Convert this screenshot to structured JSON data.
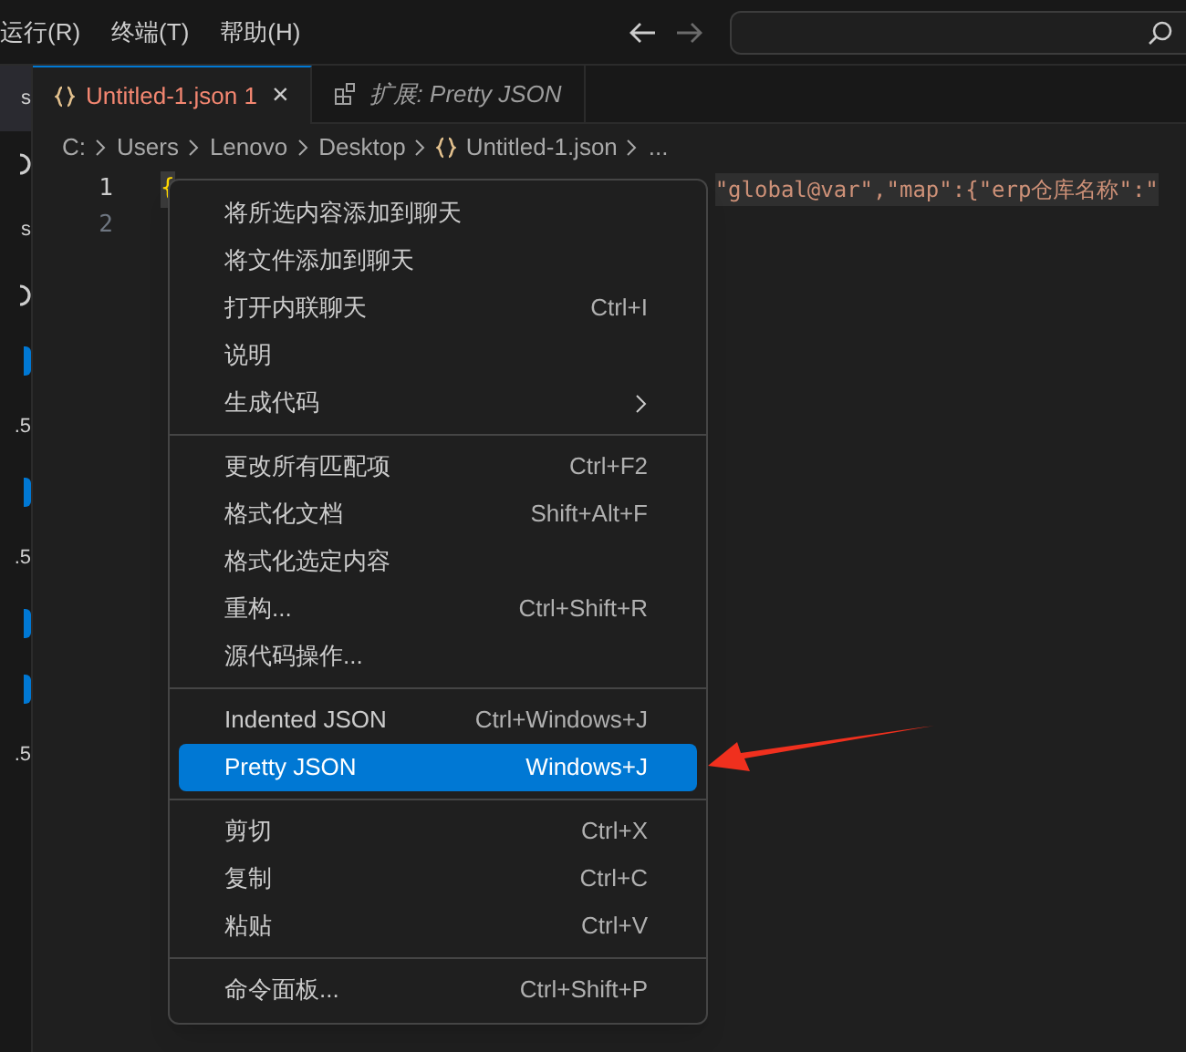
{
  "menubar": {
    "items": [
      "运行(R)",
      "终端(T)",
      "帮助(H)"
    ]
  },
  "sidebar": {
    "texts": [
      "s",
      "s",
      ".5",
      ".5",
      ".5"
    ]
  },
  "tabs": [
    {
      "label": "Untitled-1.json 1",
      "kind": "file",
      "selected": true,
      "close": "×"
    },
    {
      "label": "扩展: Pretty JSON",
      "kind": "extension",
      "selected": false
    }
  ],
  "breadcrumb": [
    {
      "label": "C:",
      "kind": "folder"
    },
    {
      "label": "Users",
      "kind": "folder"
    },
    {
      "label": "Lenovo",
      "kind": "folder"
    },
    {
      "label": "Desktop",
      "kind": "folder"
    },
    {
      "label": "Untitled-1.json",
      "kind": "file"
    },
    {
      "label": "...",
      "kind": "more"
    }
  ],
  "editor": {
    "lines": [
      {
        "number": "1",
        "start": "{",
        "tail": "\"global@var\",\"map\":{\"erp仓库名称\":\""
      },
      {
        "number": "2"
      }
    ]
  },
  "context_menu": {
    "groups": [
      [
        {
          "label": "将所选内容添加到聊天",
          "selected": false
        },
        {
          "label": "将文件添加到聊天",
          "selected": false
        },
        {
          "label": "打开内联聊天",
          "shortcut": "Ctrl+I",
          "selected": false
        },
        {
          "label": "说明",
          "selected": false
        },
        {
          "label": "生成代码",
          "submenu": true,
          "selected": false
        }
      ],
      [
        {
          "label": "更改所有匹配项",
          "shortcut": "Ctrl+F2",
          "selected": false
        },
        {
          "label": "格式化文档",
          "shortcut": "Shift+Alt+F",
          "selected": false
        },
        {
          "label": "格式化选定内容",
          "selected": false
        },
        {
          "label": "重构...",
          "shortcut": "Ctrl+Shift+R",
          "selected": false
        },
        {
          "label": "源代码操作...",
          "selected": false
        }
      ],
      [
        {
          "label": "Indented JSON",
          "shortcut": "Ctrl+Windows+J",
          "selected": false
        },
        {
          "label": "Pretty JSON",
          "shortcut": "Windows+J",
          "selected": true
        }
      ],
      [
        {
          "label": "剪切",
          "shortcut": "Ctrl+X",
          "selected": false
        },
        {
          "label": "复制",
          "shortcut": "Ctrl+C",
          "selected": false
        },
        {
          "label": "粘贴",
          "shortcut": "Ctrl+V",
          "selected": false
        }
      ],
      [
        {
          "label": "命令面板...",
          "shortcut": "Ctrl+Shift+P",
          "selected": false
        }
      ]
    ]
  }
}
